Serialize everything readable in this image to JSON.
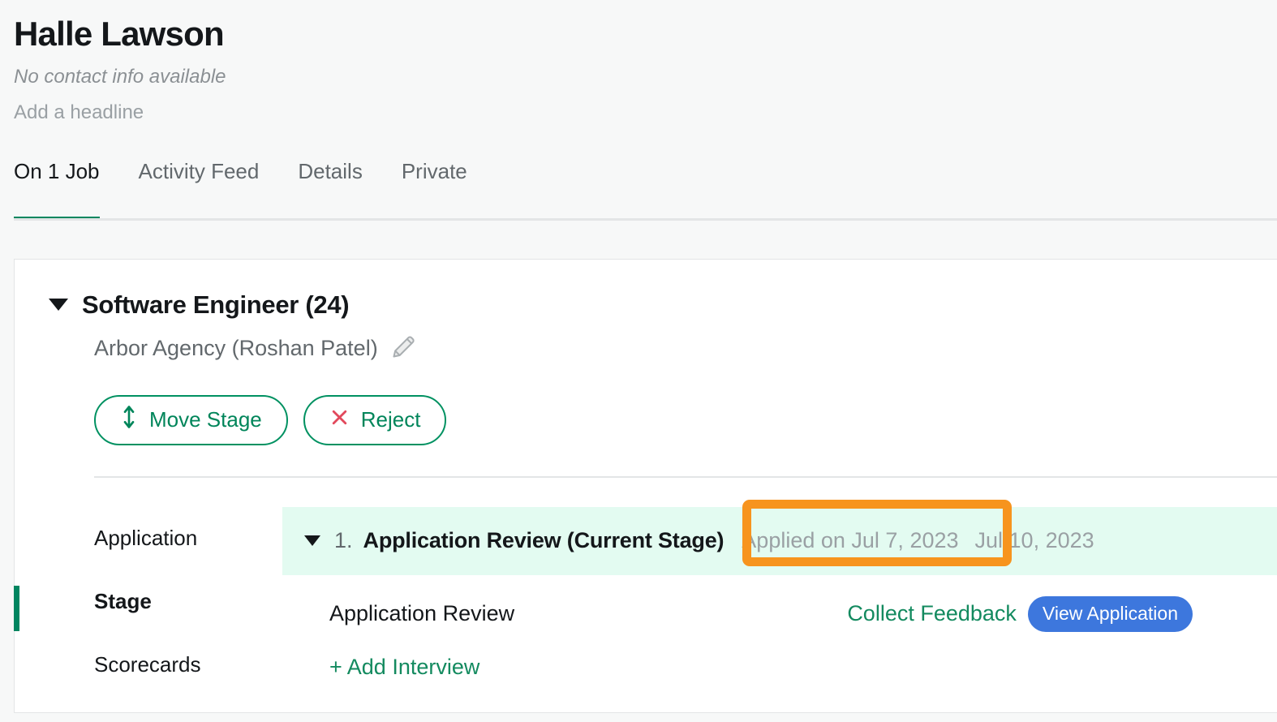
{
  "profile": {
    "name": "Halle Lawson",
    "contact_info": "No contact info available",
    "headline_placeholder": "Add a headline"
  },
  "tabs": [
    {
      "label": "On 1 Job",
      "active": true
    },
    {
      "label": "Activity Feed",
      "active": false
    },
    {
      "label": "Details",
      "active": false
    },
    {
      "label": "Private",
      "active": false
    }
  ],
  "job": {
    "title": "Software Engineer (24)",
    "agency": "Arbor Agency (Roshan Patel)",
    "edit_icon": "pencil-icon",
    "collapse_icon": "caret-down-icon",
    "actions": [
      {
        "label": "Move Stage",
        "icon": "move-vertical-arrows-icon",
        "color": "#00855a"
      },
      {
        "label": "Reject",
        "icon": "x-close-icon",
        "color": "#00855a",
        "icon_color": "#e2495c"
      }
    ]
  },
  "stage_nav": [
    {
      "label": "Application",
      "active": false
    },
    {
      "label": "Stage",
      "active": true
    },
    {
      "label": "Scorecards",
      "active": false
    }
  ],
  "stage_panel": {
    "current_stage": {
      "caret_icon": "caret-down-icon",
      "index": "1.",
      "title": "Application Review (Current Stage)",
      "applied_on": "Applied on Jul 7, 2023",
      "stage_date": "Jul 10, 2023",
      "highlight_color": "#f7941e",
      "row_background": "#e3fbf1"
    },
    "interview": {
      "label": "Application Review",
      "collect_feedback_label": "Collect Feedback",
      "view_application_label": "View Application",
      "view_application_color": "#3d77dd"
    },
    "add_interview_label": "+ Add Interview"
  },
  "colors": {
    "accent_green": "#00875f",
    "page_background": "#f7f8f8",
    "card_background": "#ffffff"
  }
}
